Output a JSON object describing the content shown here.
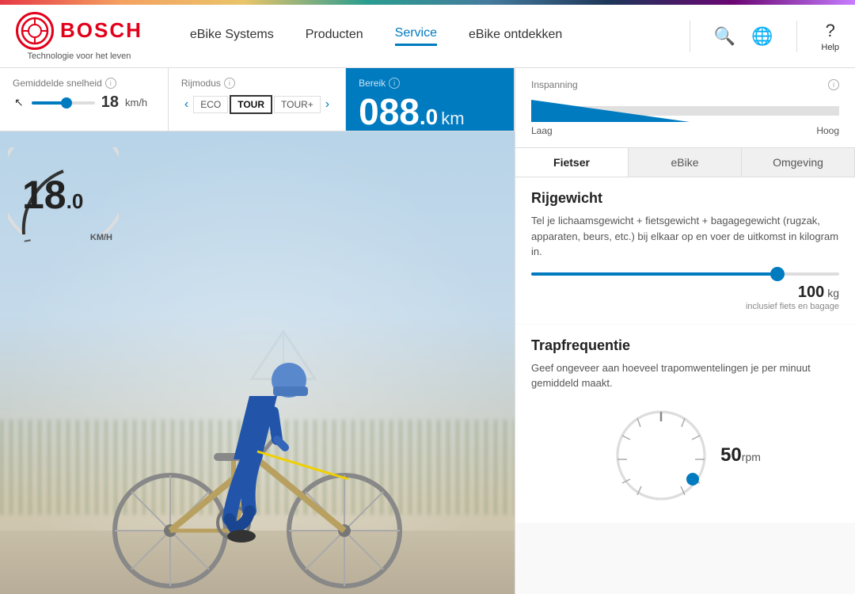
{
  "rainbow_bar": true,
  "header": {
    "logo_text": "BOSCH",
    "logo_circle_text": "⊕",
    "tagline": "Technologie voor het leven",
    "nav_items": [
      {
        "label": "eBike Systems",
        "active": false
      },
      {
        "label": "Producten",
        "active": false
      },
      {
        "label": "Service",
        "active": true
      },
      {
        "label": "eBike ontdekken",
        "active": false
      }
    ],
    "search_icon": "🔍",
    "globe_icon": "🌐",
    "help_label": "Help"
  },
  "controls": {
    "gemiddelde_snelheid": {
      "label": "Gemiddelde snelheid",
      "value": "18",
      "unit": "km/h",
      "info": "i"
    },
    "rijmodus": {
      "label": "Rijmodus",
      "modes": [
        "ECO",
        "TOUR",
        "TOUR+"
      ],
      "active_mode": "TOUR",
      "info": "i"
    },
    "bereik": {
      "label": "Bereik",
      "value": "088",
      "decimal": ".0",
      "unit": "km",
      "info": "i"
    }
  },
  "inspanning": {
    "label": "Inspanning",
    "low_label": "Laag",
    "high_label": "Hoog",
    "value": 30,
    "info": "i"
  },
  "tabs": [
    {
      "label": "Fietser",
      "active": true
    },
    {
      "label": "eBike",
      "active": false
    },
    {
      "label": "Omgeving",
      "active": false
    }
  ],
  "rijgewicht": {
    "title": "Rijgewicht",
    "description": "Tel je lichaamsgewicht + fietsgewicht + bagagegewicht (rugzak, apparaten, beurs, etc.) bij elkaar op en voer de uitkomst in kilogram in.",
    "value": 100,
    "unit": "kg",
    "note": "inclusief fiets en bagage",
    "slider_percent": 80
  },
  "trapfrequentie": {
    "title": "Trapfrequentie",
    "description": "Geef ongeveer aan hoeveel trapomwentelingen je per minuut gemiddeld maakt.",
    "value": 50,
    "unit": "rpm"
  },
  "speedometer": {
    "value": "18",
    "decimal": ".0",
    "unit": "KM/H"
  }
}
